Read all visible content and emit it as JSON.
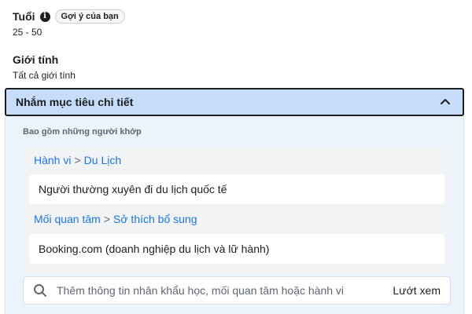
{
  "age": {
    "title": "Tuổi",
    "info_glyph": "i",
    "badge": "Gợi ý của bạn",
    "value": "25 - 50"
  },
  "gender": {
    "title": "Giới tính",
    "value": "Tất cả giới tính"
  },
  "detailed_targeting": {
    "header": "Nhắm mục tiêu chi tiết",
    "expanded": true,
    "include_label": "Bao gồm những người khớp",
    "groups": [
      {
        "category": "Hành vi",
        "separator": ">",
        "subcategory": "Du Lịch",
        "item": "Người thường xuyên đi du lịch quốc tế"
      },
      {
        "category": "Mối quan tâm",
        "separator": ">",
        "subcategory": "Sở thích bổ sung",
        "item": "Booking.com (doanh nghiệp du lịch và lữ hành)"
      }
    ],
    "search": {
      "placeholder": "Thêm thông tin nhân khẩu học, mối quan tâm hoặc hành vi",
      "value": "",
      "browse_label": "Lướt xem"
    }
  },
  "colors": {
    "link": "#1877f2",
    "header_bg": "#c6dcf8",
    "panel_bg": "#ebf3fd"
  },
  "icons": {
    "info": "info-icon",
    "chevron": "chevron-up-icon",
    "search": "search-icon"
  }
}
